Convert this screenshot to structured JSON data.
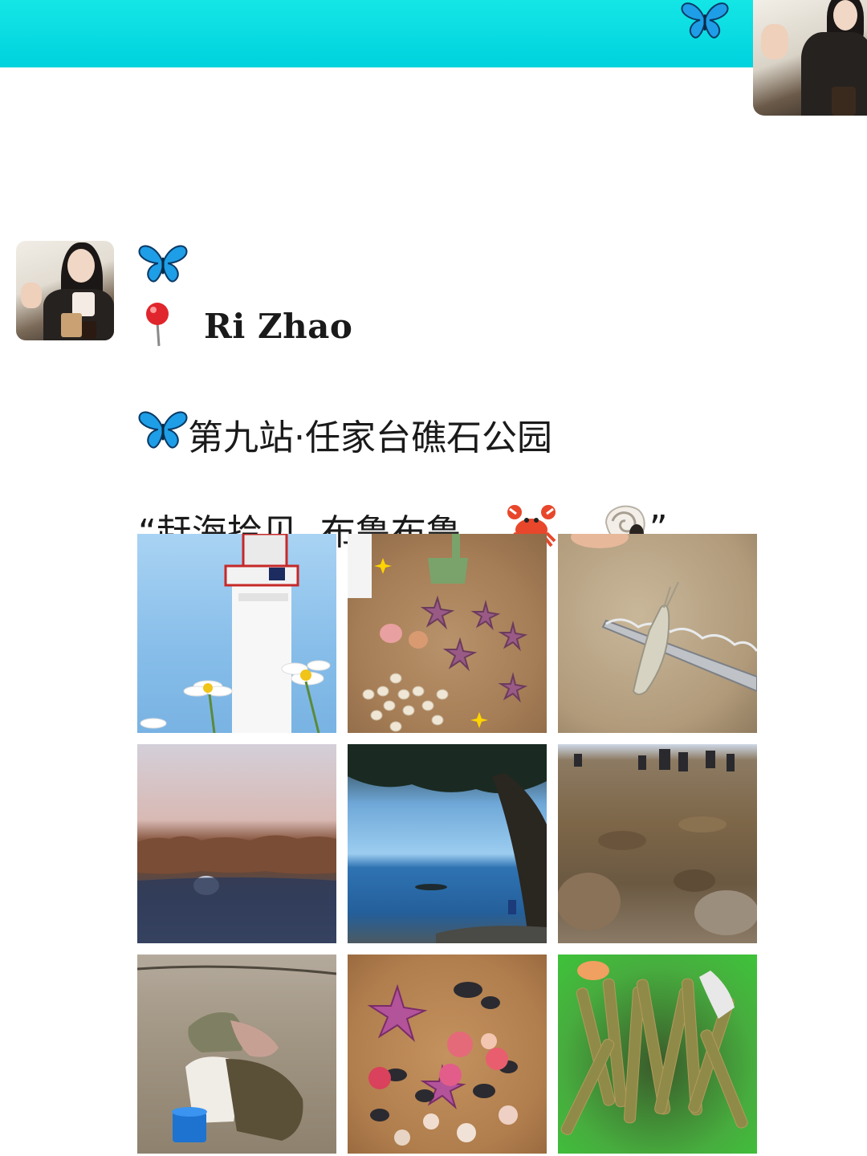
{
  "icons": {
    "butterfly": "butterfly-icon",
    "pin": "round-pushpin-icon",
    "crab": "crab-icon",
    "shell": "spiral-shell-icon"
  },
  "colors": {
    "header_cyan": "#00d9e0",
    "butterfly_blue": "#1e9ee6",
    "text": "#1a1a1a"
  },
  "post": {
    "location": "Ri Zhao",
    "title": "第九站·任家台礁石公园",
    "subtitle": "“赶海拾贝  布鲁布鲁",
    "subtitle_end": "”"
  }
}
